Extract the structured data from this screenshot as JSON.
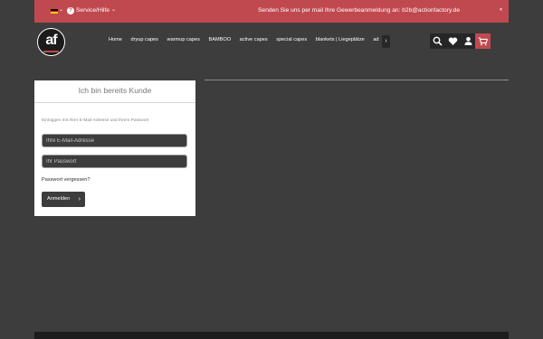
{
  "topbar": {
    "language_flag": "german-flag-icon",
    "flag_colors": [
      "#000000",
      "#dd0000",
      "#ffcc00"
    ],
    "help_glyph": "?",
    "help_label": "Service/Hilfe",
    "notice": "Senden Sie uns per mail Ihre Gewerbeanmeldung an: b2b@actionfactory.de",
    "arrows": "‹‹"
  },
  "header": {
    "logo_text": "af",
    "nav": [
      "Home",
      "dryup capes",
      "warmup capes",
      "BAMBOO",
      "active capes",
      "special capes",
      "blankets | Liegeplätze",
      "ad"
    ],
    "nav_more_icon": "chevron-right-icon",
    "icons": [
      "search-icon",
      "heart-icon",
      "user-icon",
      "cart-icon"
    ]
  },
  "login": {
    "title": "Ich bin bereits Kunde",
    "intro": "Einloggen mit Ihrer E-Mail-Adresse und Ihrem Passwort",
    "email_placeholder": "Ihre E-Mail-Adresse",
    "password_placeholder": "Ihr Passwort",
    "forgot": "Passwort vergessen?",
    "submit": "Anmelden"
  },
  "colors": {
    "accent": "#c0494f",
    "background": "#3d3d3d",
    "icon_bg": "#262626"
  }
}
